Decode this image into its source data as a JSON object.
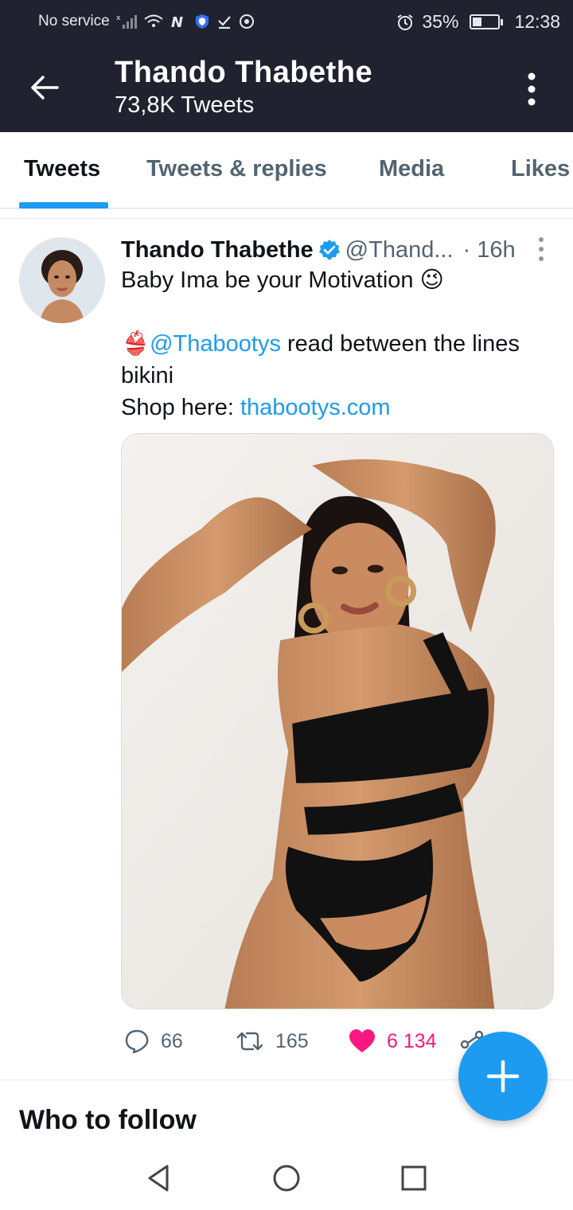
{
  "status_bar": {
    "carrier": "No service",
    "battery": "35%",
    "battery_level": 0.35,
    "time": "12:38"
  },
  "app_bar": {
    "name": "Thando Thabethe",
    "tweet_count": "73,8K Tweets",
    "back_icon": "arrow-left-icon",
    "overflow_icon": "more-vertical-icon"
  },
  "tabs": [
    {
      "label": "Tweets",
      "active": true
    },
    {
      "label": "Tweets & replies",
      "active": false
    },
    {
      "label": "Media",
      "active": false
    },
    {
      "label": "Likes",
      "active": false
    }
  ],
  "tweet": {
    "author": "Thando Thabethe",
    "handle": "@Thand...",
    "time": "· 16h",
    "text_line1": "Baby Ima be your Motivation 😉",
    "emoji_bikini": "👙",
    "mention": "@Thabootys",
    "text_line2_rest": " read between the lines",
    "text_line3": "bikini",
    "shop_prefix": "Shop here: ",
    "shop_link": "thabootys.com",
    "reply_count": "66",
    "retweet_count": "165",
    "like_count": "6 134"
  },
  "section": {
    "who_to_follow": "Who to follow"
  },
  "colors": {
    "accent": "#1d9bf0",
    "like": "#f91880",
    "header_bg": "#20232f",
    "secondary_text": "#536471"
  }
}
